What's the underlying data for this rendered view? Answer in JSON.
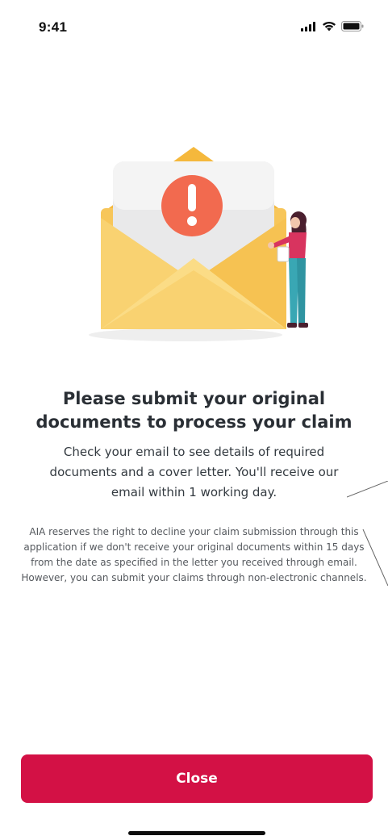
{
  "status_bar": {
    "time": "9:41",
    "icons": [
      "cellular-signal-icon",
      "wifi-icon",
      "battery-icon"
    ]
  },
  "illustration": {
    "description_icon": "envelope-alert-illustration",
    "alert_glyph": "!"
  },
  "content": {
    "heading": "Please submit your original documents to process your claim",
    "subtext": "Check your email to see details of required documents and a cover letter. You'll receive our email within 1 working day.",
    "disclaimer": "AIA reserves the right to decline your claim submission through this application if we don't receive your original documents within 15 days from the date as specified in the letter you received through email.  However, you can submit your claims through non-electronic channels."
  },
  "actions": {
    "close_label": "Close"
  },
  "colors": {
    "primary": "#d31145",
    "alert": "#f26a4f",
    "envelope": "#f7c65a",
    "heading_text": "#2a2f35",
    "body_text": "#333a40"
  }
}
